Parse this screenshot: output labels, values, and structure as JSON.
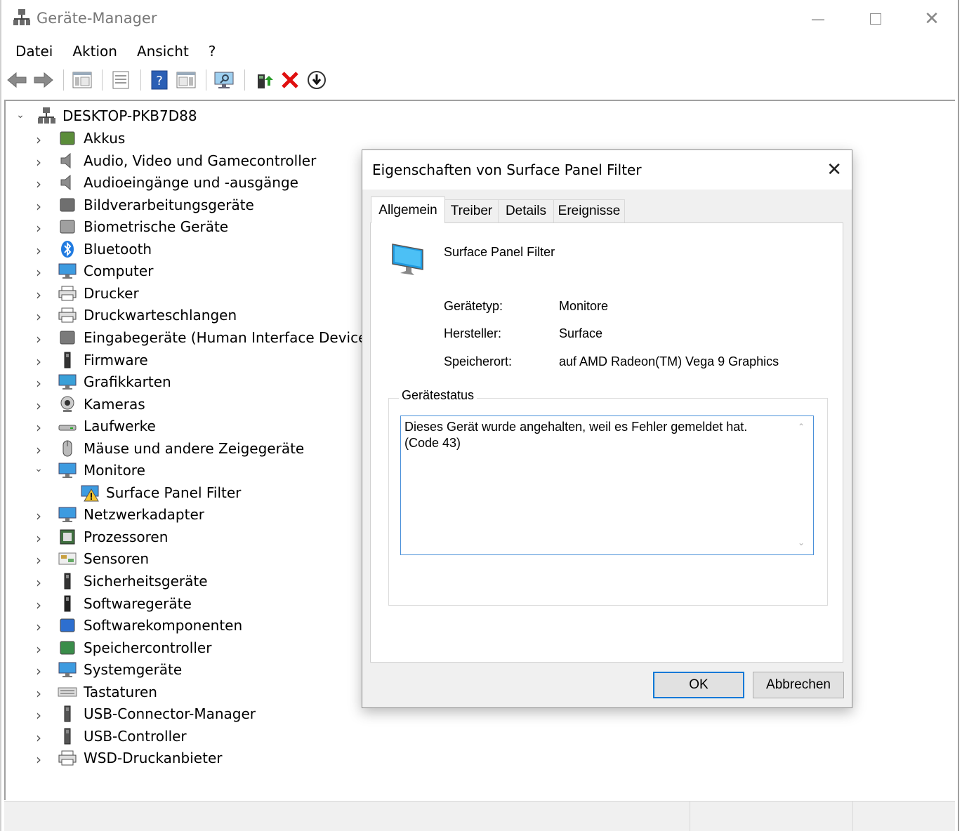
{
  "window": {
    "title": "Geräte-Manager",
    "icon": "computer-tree-icon",
    "controls": [
      "minimize",
      "maximize",
      "close"
    ]
  },
  "menubar": [
    "Datei",
    "Aktion",
    "Ansicht",
    "?"
  ],
  "toolbar": [
    "back-icon",
    "forward-icon",
    "show-hide-console-tree-icon",
    "properties-icon",
    "help-icon",
    "action-pane-icon",
    "monitor-scan-icon",
    "update-driver-icon",
    "uninstall-icon",
    "disable-device-icon"
  ],
  "tree": {
    "root": "DESKTOP-PKB7D88",
    "categories": [
      {
        "label": "Akkus",
        "icon": "battery-icon"
      },
      {
        "label": "Audio, Video und Gamecontroller",
        "icon": "speaker-icon"
      },
      {
        "label": "Audioeingänge und -ausgänge",
        "icon": "speaker-icon"
      },
      {
        "label": "Bildverarbeitungsgeräte",
        "icon": "scanner-icon"
      },
      {
        "label": "Biometrische Geräte",
        "icon": "fingerprint-icon"
      },
      {
        "label": "Bluetooth",
        "icon": "bluetooth-icon"
      },
      {
        "label": "Computer",
        "icon": "computer-icon"
      },
      {
        "label": "Drucker",
        "icon": "printer-icon"
      },
      {
        "label": "Druckwarteschlangen",
        "icon": "printer-icon"
      },
      {
        "label": "Eingabegeräte (Human Interface Devices)",
        "icon": "hid-icon"
      },
      {
        "label": "Firmware",
        "icon": "firmware-icon"
      },
      {
        "label": "Grafikkarten",
        "icon": "display-adapter-icon"
      },
      {
        "label": "Kameras",
        "icon": "camera-icon"
      },
      {
        "label": "Laufwerke",
        "icon": "drive-icon"
      },
      {
        "label": "Mäuse und andere Zeigegeräte",
        "icon": "mouse-icon"
      },
      {
        "label": "Monitore",
        "icon": "monitor-icon",
        "expanded": true,
        "children": [
          {
            "label": "Surface Panel Filter",
            "icon": "monitor-warning-icon"
          }
        ]
      },
      {
        "label": "Netzwerkadapter",
        "icon": "network-icon"
      },
      {
        "label": "Prozessoren",
        "icon": "processor-icon"
      },
      {
        "label": "Sensoren",
        "icon": "sensor-icon"
      },
      {
        "label": "Sicherheitsgeräte",
        "icon": "security-key-icon"
      },
      {
        "label": "Softwaregeräte",
        "icon": "software-device-icon"
      },
      {
        "label": "Softwarekomponenten",
        "icon": "software-component-icon"
      },
      {
        "label": "Speichercontroller",
        "icon": "storage-controller-icon"
      },
      {
        "label": "Systemgeräte",
        "icon": "system-device-icon"
      },
      {
        "label": "Tastaturen",
        "icon": "keyboard-icon"
      },
      {
        "label": "USB-Connector-Manager",
        "icon": "usb-icon"
      },
      {
        "label": "USB-Controller",
        "icon": "usb-icon"
      },
      {
        "label": "WSD-Druckanbieter",
        "icon": "printer-icon"
      }
    ]
  },
  "dialog": {
    "title": "Eigenschaften von Surface Panel Filter",
    "tabs": [
      "Allgemein",
      "Treiber",
      "Details",
      "Ereignisse"
    ],
    "active_tab": "Allgemein",
    "device_name": "Surface Panel Filter",
    "fields": [
      {
        "label": "Gerätetyp:",
        "value": "Monitore"
      },
      {
        "label": "Hersteller:",
        "value": "Surface"
      },
      {
        "label": "Speicherort:",
        "value": "auf AMD Radeon(TM) Vega 9 Graphics"
      }
    ],
    "status_legend": "Gerätestatus",
    "status_text": "Dieses Gerät wurde angehalten, weil es Fehler gemeldet hat.\n(Code 43)",
    "ok_label": "OK",
    "cancel_label": "Abbrechen"
  }
}
